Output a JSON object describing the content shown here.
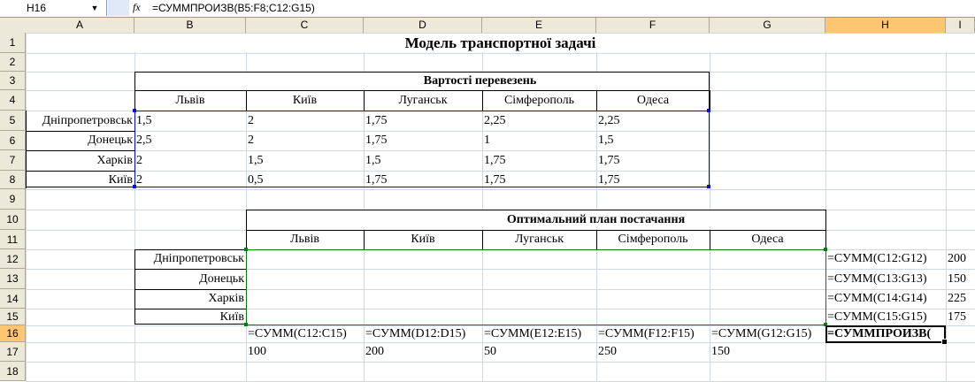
{
  "formula_bar": {
    "name_box": "H16",
    "fx_label": "fx",
    "formula": "=СУММПРОИЗВ(B5:F8;C12:G15)"
  },
  "columns": [
    "A",
    "B",
    "C",
    "D",
    "E",
    "F",
    "G",
    "H",
    "I"
  ],
  "rows": [
    "1",
    "2",
    "3",
    "4",
    "5",
    "6",
    "7",
    "8",
    "9",
    "10",
    "11",
    "12",
    "13",
    "14",
    "15",
    "16",
    "17",
    "18"
  ],
  "title": "Модель транспортної задачі",
  "costs": {
    "title": "Вартості перевезень",
    "headers": [
      "Львів",
      "Київ",
      "Луганськ",
      "Сімферополь",
      "Одеса"
    ],
    "rows": [
      {
        "label": "Дніпропетровськ",
        "values": [
          "1,5",
          "2",
          "1,75",
          "2,25",
          "2,25"
        ]
      },
      {
        "label": "Донецьк",
        "values": [
          "2,5",
          "2",
          "1,75",
          "1",
          "1,5"
        ]
      },
      {
        "label": "Харків",
        "values": [
          "2",
          "1,5",
          "1,5",
          "1,75",
          "1,75"
        ]
      },
      {
        "label": "Київ",
        "values": [
          "2",
          "0,5",
          "1,75",
          "1,75",
          "1,75"
        ]
      }
    ]
  },
  "plan": {
    "title": "Оптимальний план постачання",
    "headers": [
      "Львів",
      "Київ",
      "Луганськ",
      "Сімферополь",
      "Одеса"
    ],
    "row_labels": [
      "Дніпропетровськ",
      "Донецьк",
      "Харків",
      "Київ"
    ],
    "row_sums": [
      "=СУММ(C12:G12)",
      "=СУММ(C13:G13)",
      "=СУММ(C14:G14)",
      "=СУММ(C15:G15)"
    ],
    "supply": [
      "200",
      "150",
      "225",
      "175"
    ],
    "col_sums": [
      "=СУММ(C12:C15)",
      "=СУММ(D12:D15)",
      "=СУММ(E12:E15)",
      "=СУММ(F12:F15)",
      "=СУММ(G12:G15)"
    ],
    "total": "=СУММПРОИЗВ(",
    "demand": [
      "100",
      "200",
      "50",
      "250",
      "150"
    ]
  }
}
